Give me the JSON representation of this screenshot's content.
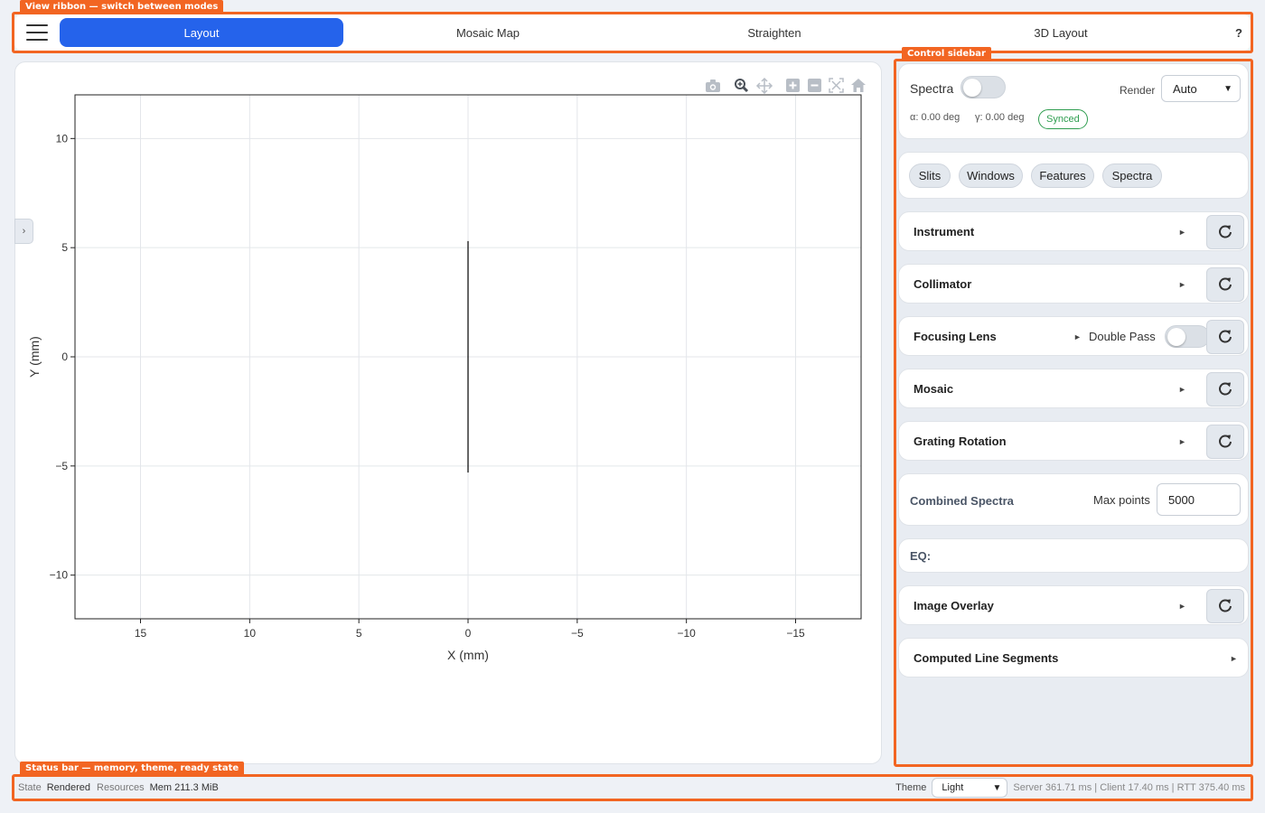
{
  "annotations": {
    "ribbon": "View ribbon — switch between modes",
    "sidebar": "Control sidebar",
    "statusbar": "Status bar — memory, theme, ready state"
  },
  "ribbon": {
    "tabs": [
      "Layout",
      "Mosaic Map",
      "Straighten",
      "3D Layout"
    ],
    "active_tab": "Layout",
    "help": "?"
  },
  "plot": {
    "toolbar_icons": [
      "camera-icon",
      "zoom-icon",
      "pan-icon",
      "zoom-in-icon",
      "zoom-out-icon",
      "autoscale-icon",
      "reset-axes-icon"
    ],
    "collapse_arrow": "›"
  },
  "chart_data": {
    "type": "line",
    "xlabel": "X (mm)",
    "ylabel": "Y (mm)",
    "xlim": [
      18,
      -18
    ],
    "ylim": [
      -12,
      12
    ],
    "x_reversed": true,
    "xticks": [
      15,
      10,
      5,
      0,
      -5,
      -10,
      -15
    ],
    "xtick_labels": [
      "15",
      "10",
      "5",
      "0",
      "−5",
      "−10",
      "−15"
    ],
    "yticks": [
      10,
      5,
      0,
      -5,
      -10
    ],
    "ytick_labels": [
      "10",
      "5",
      "0",
      "−5",
      "−10"
    ],
    "grid": true,
    "series": [
      {
        "x": [
          0,
          0
        ],
        "y": [
          5.3,
          -5.3
        ],
        "color": "#000000"
      }
    ]
  },
  "sidebar": {
    "spectra_label": "Spectra",
    "spectra_toggle": false,
    "render_label": "Render",
    "render_value": "Auto",
    "alpha_text": "α: 0.00 deg",
    "gamma_text": "γ: 0.00 deg",
    "synced_badge": "Synced",
    "synced_color": "#2e9d4f",
    "chips": [
      "Slits",
      "Windows",
      "Features",
      "Spectra"
    ],
    "sections": {
      "instrument": "Instrument",
      "collimator": "Collimator",
      "focusing_lens": "Focusing Lens",
      "double_pass": "Double Pass",
      "double_pass_toggle": false,
      "mosaic": "Mosaic",
      "grating_rotation": "Grating Rotation",
      "combined_spectra": "Combined Spectra",
      "max_points_label": "Max points",
      "max_points_value": "5000",
      "eq": "EQ:",
      "image_overlay": "Image Overlay",
      "computed_line_segments": "Computed Line Segments"
    },
    "arrow_glyph": "►"
  },
  "statusbar": {
    "state_label": "State",
    "state_value": "Rendered",
    "resources_label": "Resources",
    "mem_value": "Mem 211.3 MiB",
    "theme_label": "Theme",
    "theme_value": "Light",
    "timing": "Server 361.71 ms | Client 17.40 ms | RTT 375.40 ms"
  },
  "colors": {
    "accent": "#2563eb",
    "annotation": "#f26522"
  }
}
